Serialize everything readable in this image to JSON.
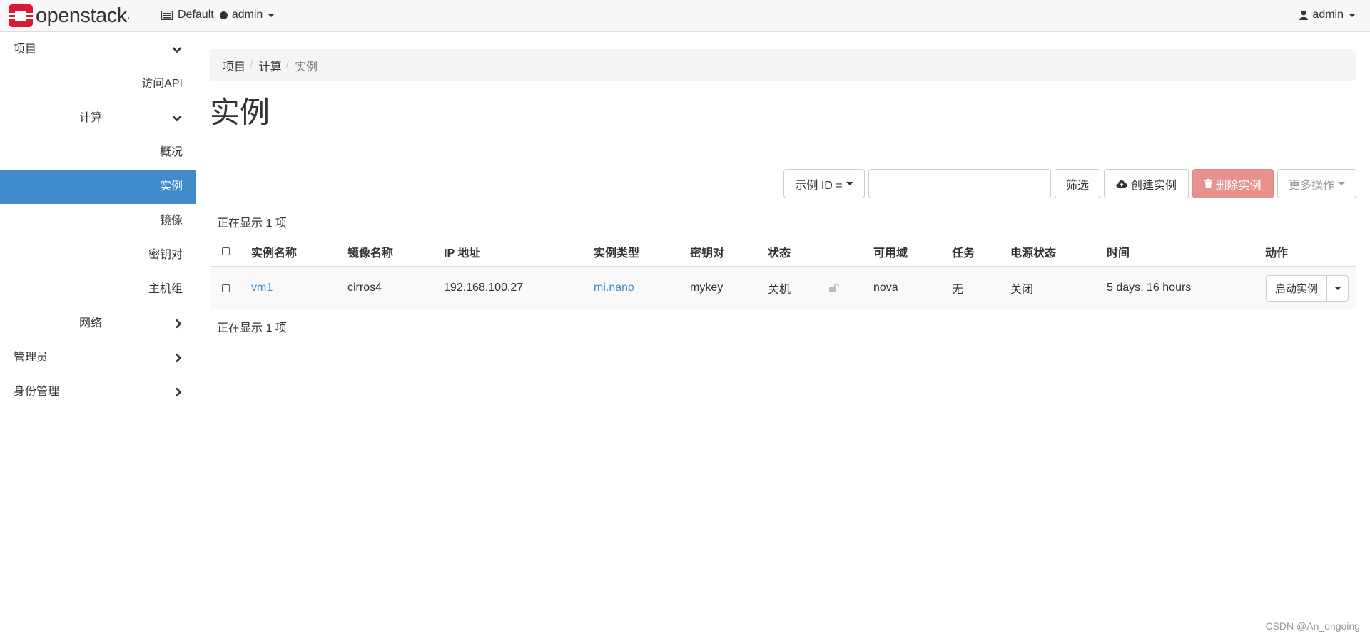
{
  "brand": {
    "name": "openstack",
    "trademark": "."
  },
  "context": {
    "domain": "Default",
    "project": "admin"
  },
  "user": {
    "name": "admin"
  },
  "sidebar": {
    "project": "项目",
    "access_api": "访问API",
    "compute": "计算",
    "overview": "概况",
    "instances": "实例",
    "images": "镜像",
    "key_pairs": "密钥对",
    "server_groups": "主机组",
    "network": "网络",
    "admin": "管理员",
    "identity": "身份管理"
  },
  "breadcrumb": {
    "items": [
      "项目",
      "计算",
      "实例"
    ],
    "separator": "/"
  },
  "page_title": "实例",
  "toolbar": {
    "filter_field": "示例 ID =",
    "filter_value": "",
    "filter_button": "筛选",
    "create_button": "创建实例",
    "delete_button": "删除实例",
    "more_button": "更多操作"
  },
  "table": {
    "count_text": "正在显示 1 项",
    "headers": {
      "name": "实例名称",
      "image": "镜像名称",
      "ip": "IP 地址",
      "flavor": "实例类型",
      "keypair": "密钥对",
      "status": "状态",
      "az": "可用域",
      "task": "任务",
      "power": "电源状态",
      "age": "时间",
      "actions": "动作"
    },
    "rows": [
      {
        "name": "vm1",
        "image": "cirros4",
        "ip": "192.168.100.27",
        "flavor": "mi.nano",
        "keypair": "mykey",
        "status": "关机",
        "az": "nova",
        "task": "无",
        "power": "关闭",
        "age": "5 days, 16 hours",
        "action": "启动实例"
      }
    ]
  },
  "watermark": "CSDN @An_ongoing",
  "colors": {
    "accent": "#428bca",
    "danger": "#e8928f",
    "brand_red": "#da1a32"
  },
  "icons": [
    "openstack-logo-icon",
    "project-list-icon",
    "user-icon",
    "chevron-down-icon",
    "chevron-right-icon",
    "cloud-upload-icon",
    "trash-icon",
    "unlock-icon",
    "caret-down-icon"
  ]
}
